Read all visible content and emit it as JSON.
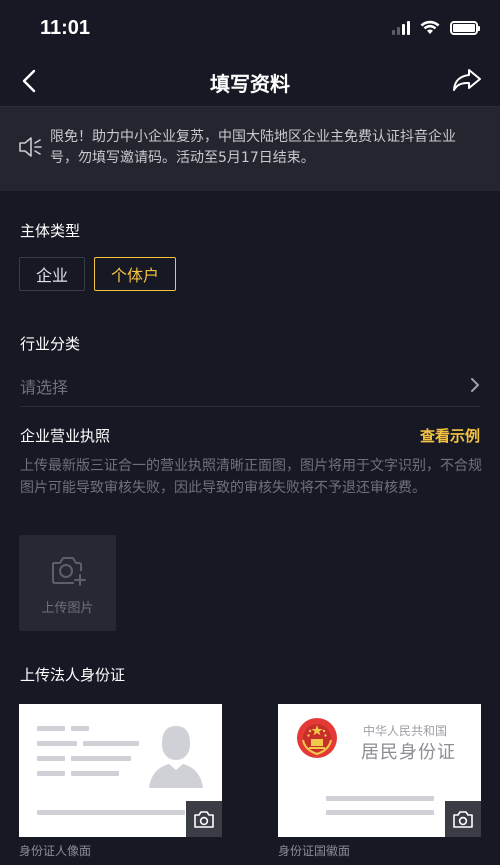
{
  "status_bar": {
    "time": "11:01"
  },
  "nav": {
    "title": "填写资料",
    "back_icon": "back-arrow-icon",
    "share_icon": "share-arrow-icon"
  },
  "notice": {
    "icon": "speaker-icon",
    "text": "限免！助力中小企业复苏，中国大陆地区企业主免费认证抖音企业号，勿填写邀请码。活动至5月17日结束。"
  },
  "entity_type": {
    "label": "主体类型",
    "options": [
      {
        "label": "企业",
        "selected": false
      },
      {
        "label": "个体户",
        "selected": true
      }
    ]
  },
  "industry": {
    "label": "行业分类",
    "placeholder": "请选择"
  },
  "business_license": {
    "label": "企业营业执照",
    "example_link": "查看示例",
    "description": "上传最新版三证合一的营业执照清晰正面图，图片将用于文字识别，不合规图片可能导致审核失败，因此导致的审核失败将不予退还审核费。",
    "upload_label": "上传图片"
  },
  "legal_id": {
    "label": "上传法人身份证",
    "front": {
      "caption": "身份证人像面"
    },
    "back": {
      "caption": "身份证国徽面",
      "title": "中华人民共和国",
      "subtitle": "居民身份证"
    }
  },
  "colors": {
    "background": "#161823",
    "accent": "#f5c242",
    "panel": "#23252f"
  }
}
